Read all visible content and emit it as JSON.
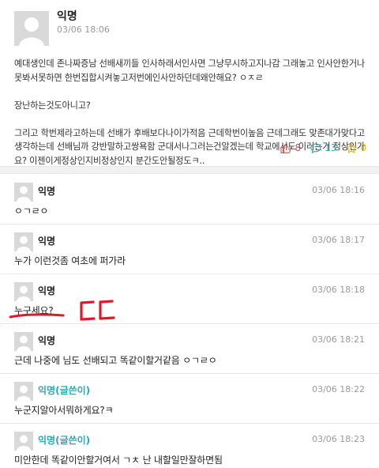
{
  "post": {
    "author": "익명",
    "time": "03/06 18:06",
    "body": "예대생인데 존나짜증남 선배새끼들 인사하래서인사면 그냥무시하고지나감 그래놓고 인사안한거나 못봐서못하면 한번집합시켜놓고저번에인사안하던데왜안해요? ㅇㅈㄹ\n\n장난하는것도아니고?\n\n그리고 학번제라고하는데 선배가 후배보다나이가적음 근데학번이높음 근데그래도 맞존대가맞다고생각하는데 선배님까 강반말하고쌍욕함 군대서나그러는건알겠는데 학교에서도 이러는거 정상인가요? 이젠이게정상인지비정상인지 분간도안될정도ㅋ..",
    "likes": "8",
    "comments": "13",
    "scraps": "0",
    "colors": {
      "like": "#e24a4a",
      "comment": "#2aa9b5",
      "scrap": "#e8b800"
    },
    "icons": {
      "like": "thumbs-up-icon",
      "comment": "comment-bubble-icon",
      "scrap": "star-icon"
    }
  },
  "comments": [
    {
      "author": "익명",
      "time": "03/06 18:16",
      "text": "ㅇㄱㄹㅇ",
      "is_op": false
    },
    {
      "author": "익명",
      "time": "03/06 18:17",
      "text": "누가 이런것좀 여초에 퍼가라",
      "is_op": false
    },
    {
      "author": "익명",
      "time": "03/06 18:18",
      "text": "누구세요?",
      "is_op": false
    },
    {
      "author": "익명",
      "time": "03/06 18:21",
      "text": "근데 나중에 님도 선배되고 똑같이할거같음 ㅇㄱㄹㅇ",
      "is_op": false
    },
    {
      "author": "익명(글쓴이)",
      "time": "03/06 18:22",
      "text": "누군지알아서뭐하게요?ㅋ",
      "is_op": true
    },
    {
      "author": "익명(글쓴이)",
      "time": "03/06 18:23",
      "text": "미안한데 똑같이안할거여서 ㄱㅊ 난 내할일만잘하면됨",
      "is_op": true
    }
  ],
  "annotation": {
    "text": "ㄷㄷ",
    "color": "#e0192a"
  },
  "colors": {
    "op_author": "#2aa9b5",
    "avatar": "#d9d9d9"
  }
}
